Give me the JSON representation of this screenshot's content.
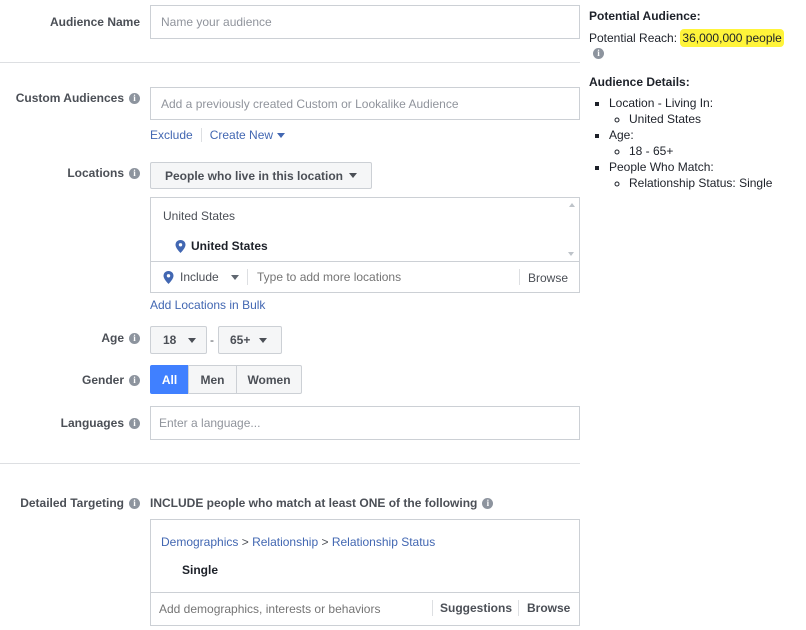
{
  "audience_name": {
    "label": "Audience Name",
    "placeholder": "Name your audience"
  },
  "custom_audiences": {
    "label": "Custom Audiences",
    "placeholder": "Add a previously created Custom or Lookalike Audience",
    "exclude": "Exclude",
    "create_new": "Create New"
  },
  "locations": {
    "label": "Locations",
    "type_select": "People who live in this location",
    "group_header": "United States",
    "selected": "United States",
    "include": "Include",
    "placeholder": "Type to add more locations",
    "browse": "Browse",
    "bulk": "Add Locations in Bulk"
  },
  "age": {
    "label": "Age",
    "min": "18",
    "separator": "-",
    "max": "65+"
  },
  "gender": {
    "label": "Gender",
    "options": [
      "All",
      "Men",
      "Women"
    ],
    "selected": "All"
  },
  "languages": {
    "label": "Languages",
    "placeholder": "Enter a language..."
  },
  "detailed_targeting": {
    "label": "Detailed Targeting",
    "description": "INCLUDE people who match at least ONE of the following",
    "breadcrumb": [
      "Demographics",
      "Relationship",
      "Relationship Status"
    ],
    "crumb_separator": ">",
    "selected": "Single",
    "placeholder": "Add demographics, interests or behaviors",
    "suggestions": "Suggestions",
    "browse": "Browse"
  },
  "summary": {
    "potential_audience_title": "Potential Audience:",
    "potential_reach_label": "Potential Reach:",
    "potential_reach_value": "36,000,000 people",
    "details_title": "Audience Details:",
    "details": [
      {
        "label": "Location - Living In:",
        "sub": [
          "United States"
        ]
      },
      {
        "label": "Age:",
        "sub": [
          "18 - 65+"
        ]
      },
      {
        "label": "People Who Match:",
        "sub": [
          "Relationship Status: Single"
        ]
      }
    ]
  },
  "colors": {
    "link": "#4267b2",
    "active_segment": "#4080ff",
    "highlight": "#fff43a"
  }
}
